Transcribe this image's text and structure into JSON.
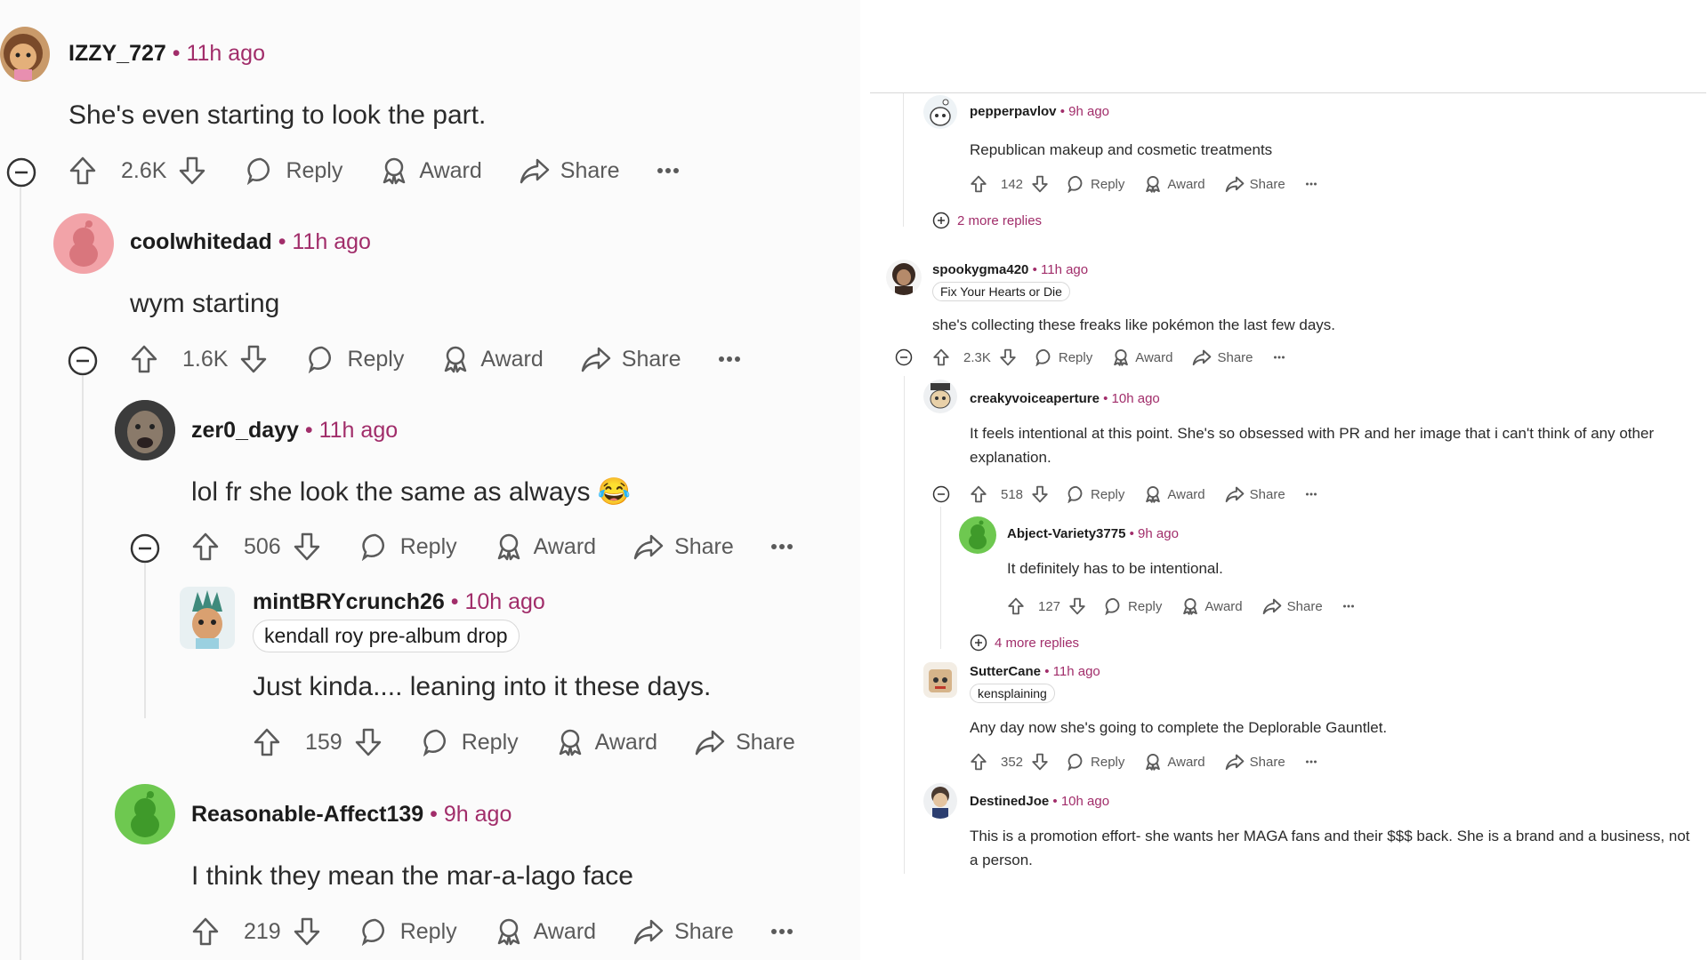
{
  "left": {
    "comments": [
      {
        "user": "IZZY_727",
        "time": "11h ago",
        "body": "She's even starting to look the part.",
        "score": "2.6K",
        "reply": "Reply",
        "award": "Award",
        "share": "Share"
      },
      {
        "user": "coolwhitedad",
        "time": "11h ago",
        "body": "wym starting",
        "score": "1.6K",
        "reply": "Reply",
        "award": "Award",
        "share": "Share"
      },
      {
        "user": "zer0_dayy",
        "time": "11h ago",
        "body": "lol fr she look the same as always",
        "emoji": "😂",
        "score": "506",
        "reply": "Reply",
        "award": "Award",
        "share": "Share"
      },
      {
        "user": "mintBRYcrunch26",
        "time": "10h ago",
        "flair": "kendall roy pre-album drop",
        "body": "Just kinda.... leaning into it these days.",
        "score": "159",
        "reply": "Reply",
        "award": "Award",
        "share": "Share"
      },
      {
        "user": "Reasonable-Affect139",
        "time": "9h ago",
        "body": "I think they mean the mar-a-lago face",
        "score": "219",
        "reply": "Reply",
        "award": "Award",
        "share": "Share"
      }
    ]
  },
  "right": {
    "comments": [
      {
        "user": "pepperpavlov",
        "time": "9h ago",
        "body": "Republican makeup and cosmetic treatments",
        "score": "142",
        "reply": "Reply",
        "award": "Award",
        "share": "Share"
      },
      {
        "user": "spookygma420",
        "time": "11h ago",
        "flair": "Fix Your Hearts or Die",
        "body": "she's collecting these freaks like pokémon the last few days.",
        "score": "2.3K",
        "reply": "Reply",
        "award": "Award",
        "share": "Share"
      },
      {
        "user": "creakyvoiceaperture",
        "time": "10h ago",
        "body": "It feels intentional at this point. She's so obsessed with PR and her image that i can't think of any other explanation.",
        "score": "518",
        "reply": "Reply",
        "award": "Award",
        "share": "Share"
      },
      {
        "user": "Abject-Variety3775",
        "time": "9h ago",
        "body": "It definitely has to be intentional.",
        "score": "127",
        "reply": "Reply",
        "award": "Award",
        "share": "Share"
      },
      {
        "user": "SutterCane",
        "time": "11h ago",
        "flair": "kensplaining",
        "body": "Any day now she's going to complete the Deplorable Gauntlet.",
        "score": "352",
        "reply": "Reply",
        "award": "Award",
        "share": "Share"
      },
      {
        "user": "DestinedJoe",
        "time": "10h ago",
        "body": "This is a promotion effort- she wants her MAGA fans and their $$$ back. She is a brand and a business, not a person."
      }
    ],
    "more_replies_1": "2 more replies",
    "more_replies_2": "4 more replies"
  },
  "separator": "•",
  "colors": {
    "meta": "#a12d6a",
    "text": "#2a2a2a",
    "icon": "#5a5a5a",
    "snoo_pink": "#f2a3a8",
    "snoo_green": "#6ec850"
  }
}
